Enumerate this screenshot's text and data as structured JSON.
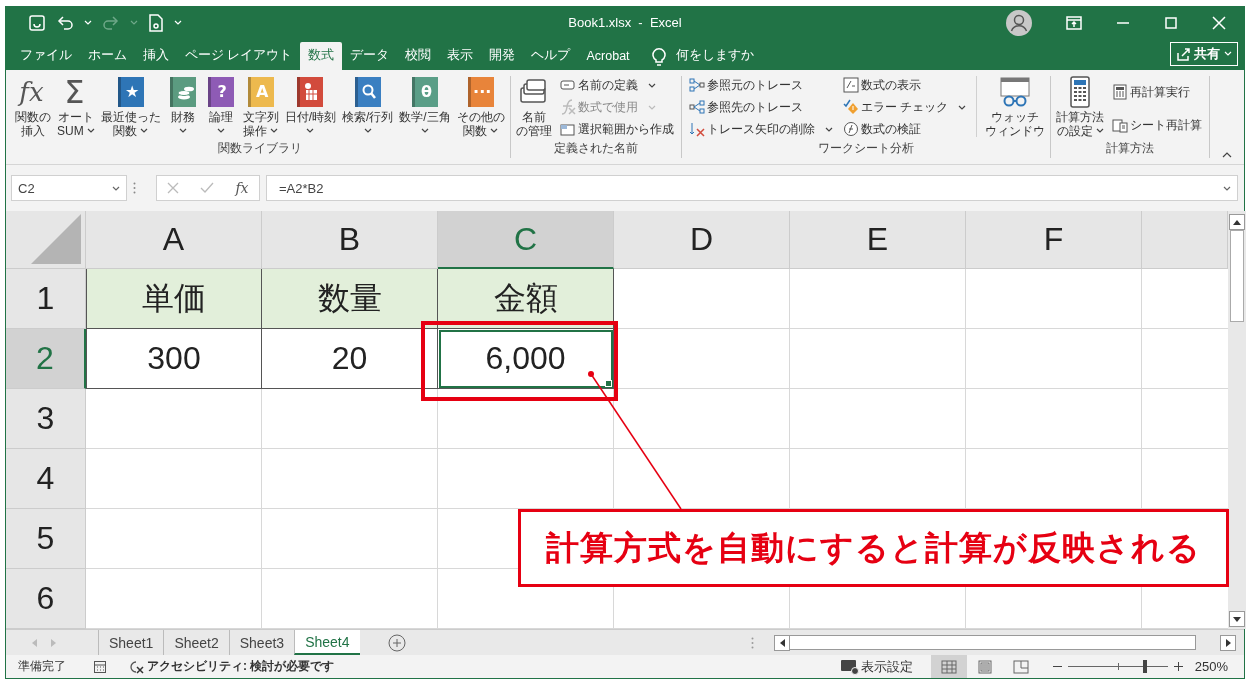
{
  "window": {
    "title": "Book1.xlsx  -  Excel"
  },
  "tabs": [
    {
      "label": "ファイル",
      "selected": false
    },
    {
      "label": "ホーム",
      "selected": false
    },
    {
      "label": "挿入",
      "selected": false
    },
    {
      "label": "ページ レイアウト",
      "selected": false
    },
    {
      "label": "数式",
      "selected": true
    },
    {
      "label": "データ",
      "selected": false
    },
    {
      "label": "校閲",
      "selected": false
    },
    {
      "label": "表示",
      "selected": false
    },
    {
      "label": "開発",
      "selected": false
    },
    {
      "label": "ヘルプ",
      "selected": false
    },
    {
      "label": "Acrobat",
      "selected": false
    }
  ],
  "tell_me": {
    "label": "何をしますか"
  },
  "share_button": {
    "label": "共有"
  },
  "ribbon": {
    "groups": [
      {
        "label": "関数ライブラリ",
        "sections": [
          {
            "kind": "large",
            "buttons": [
              {
                "lines": [
                  "関数の",
                  "挿入"
                ],
                "dropdown": false,
                "glyph": "fx"
              },
              {
                "lines": [
                  "オート",
                  "SUM"
                ],
                "dropdown": true,
                "glyph": "Σ"
              },
              {
                "lines": [
                  "最近使った",
                  "関数"
                ],
                "dropdown": true,
                "color": "#2e75b6",
                "glyph": "★"
              },
              {
                "lines": [
                  "財務"
                ],
                "dropdown": true,
                "color": "#5b9b80"
              },
              {
                "lines": [
                  "論理"
                ],
                "dropdown": true,
                "color": "#8e5bb5",
                "glyph": "?"
              },
              {
                "lines": [
                  "文字列",
                  "操作"
                ],
                "dropdown": true,
                "color": "#edb94e",
                "glyph": "A"
              },
              {
                "lines": [
                  "日付/時刻"
                ],
                "dropdown": true,
                "color": "#d24b3c"
              },
              {
                "lines": [
                  "検索/行列"
                ],
                "dropdown": true,
                "color": "#3a7fc1"
              },
              {
                "lines": [
                  "数学/三角"
                ],
                "dropdown": true,
                "color": "#5a9e87",
                "glyph": "θ"
              },
              {
                "lines": [
                  "その他の",
                  "関数"
                ],
                "dropdown": true,
                "color": "#e8843a",
                "glyph": "···"
              }
            ]
          }
        ]
      },
      {
        "label": "定義された名前",
        "sections": [
          {
            "kind": "large",
            "buttons": [
              {
                "lines": [
                  "名前",
                  "の管理"
                ],
                "dropdown": false
              }
            ]
          },
          {
            "kind": "small",
            "buttons": [
              {
                "label": "名前の定義",
                "dropdown": true,
                "disabled": false
              },
              {
                "label": "数式で使用",
                "dropdown": true,
                "disabled": true
              },
              {
                "label": "選択範囲から作成",
                "dropdown": false,
                "disabled": false
              }
            ]
          }
        ]
      },
      {
        "label": "ワークシート分析",
        "sections": [
          {
            "kind": "small",
            "buttons": [
              {
                "label": "参照元のトレース",
                "dropdown": false,
                "disabled": false
              },
              {
                "label": "参照先のトレース",
                "dropdown": false,
                "disabled": false
              },
              {
                "label": "トレース矢印の削除",
                "dropdown": true,
                "disabled": false
              }
            ]
          },
          {
            "kind": "small",
            "buttons": [
              {
                "label": "数式の表示",
                "dropdown": false,
                "disabled": false
              },
              {
                "label": "エラー チェック",
                "dropdown": true,
                "disabled": false
              },
              {
                "label": "数式の検証",
                "dropdown": false,
                "disabled": false
              }
            ]
          },
          {
            "kind": "large",
            "buttons": [
              {
                "lines": [
                  "ウォッチ",
                  "ウィンドウ"
                ],
                "dropdown": false
              }
            ]
          }
        ]
      },
      {
        "label": "計算方法",
        "sections": [
          {
            "kind": "large",
            "buttons": [
              {
                "lines": [
                  "計算方法",
                  "の設定"
                ],
                "dropdown": true
              }
            ]
          },
          {
            "kind": "small",
            "buttons": [
              {
                "label": "再計算実行",
                "dropdown": false,
                "disabled": false
              },
              {
                "label": "シート再計算",
                "dropdown": false,
                "disabled": false
              }
            ]
          }
        ]
      }
    ]
  },
  "formula_bar": {
    "name_box": "C2",
    "function_glyph": "fx",
    "formula": "=A2*B2"
  },
  "sheet": {
    "columns": [
      {
        "label": "A",
        "selected": false
      },
      {
        "label": "B",
        "selected": false
      },
      {
        "label": "C",
        "selected": true
      },
      {
        "label": "D",
        "selected": false
      },
      {
        "label": "E",
        "selected": false
      },
      {
        "label": "F",
        "selected": false
      }
    ],
    "rows": [
      {
        "label": "1",
        "selected": false,
        "kind": "header",
        "cells": [
          {
            "text": "単価",
            "selected": false
          },
          {
            "text": "数量",
            "selected": false
          },
          {
            "text": "金額",
            "selected": false
          }
        ]
      },
      {
        "label": "2",
        "selected": true,
        "kind": "data",
        "cells": [
          {
            "text": "300",
            "selected": false
          },
          {
            "text": "20",
            "selected": false
          },
          {
            "text": "6,000",
            "selected": true
          }
        ]
      },
      {
        "label": "3",
        "selected": false
      },
      {
        "label": "4",
        "selected": false
      },
      {
        "label": "5",
        "selected": false
      },
      {
        "label": "6",
        "selected": false
      }
    ]
  },
  "callout": {
    "text": "計算方式を自動にすると計算が反映される"
  },
  "sheet_tabs": [
    {
      "label": "Sheet1",
      "selected": false
    },
    {
      "label": "Sheet2",
      "selected": false
    },
    {
      "label": "Sheet3",
      "selected": false
    },
    {
      "label": "Sheet4",
      "selected": true
    }
  ],
  "status_bar": {
    "ready": "準備完了",
    "accessibility": "アクセシビリティ: 検討が必要です",
    "display_settings": "表示設定",
    "views": [
      {
        "kind": "normal",
        "selected": true
      },
      {
        "kind": "page-layout",
        "selected": false
      },
      {
        "kind": "page-break",
        "selected": false
      }
    ],
    "zoom": {
      "level": 0.77,
      "reading": "250%"
    }
  }
}
